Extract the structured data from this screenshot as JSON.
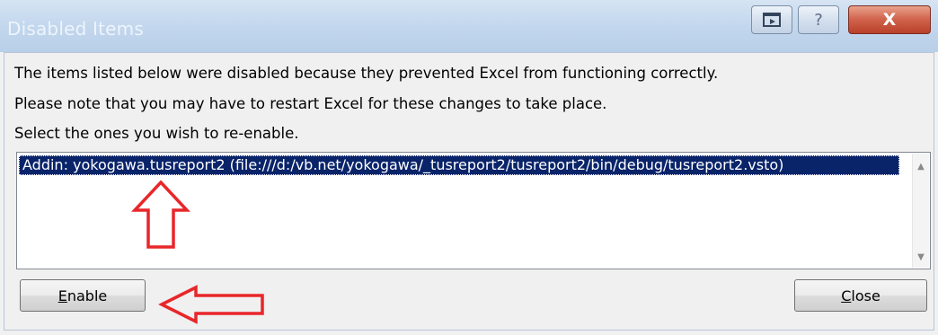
{
  "window": {
    "title": "Disabled Items",
    "caption_buttons": {
      "menu_icon": "window-menu-icon",
      "help": "?",
      "close": "X"
    }
  },
  "message": {
    "line1": "The items listed below were disabled because they prevented Excel from functioning correctly.",
    "line2": "Please note that you may have to restart Excel for these changes to take place.",
    "line3": "Select the ones you wish to re-enable."
  },
  "list": {
    "items": [
      "Addin: yokogawa.tusreport2 (file:///d:/vb.net/yokogawa/_tusreport2/tusreport2/bin/debug/tusreport2.vsto)"
    ],
    "selected_index": 0
  },
  "buttons": {
    "enable": {
      "mnemonic": "E",
      "rest": "nable"
    },
    "close": {
      "mnemonic": "C",
      "rest": "lose"
    }
  },
  "annotations": {
    "arrow_color": "#e8262a"
  }
}
